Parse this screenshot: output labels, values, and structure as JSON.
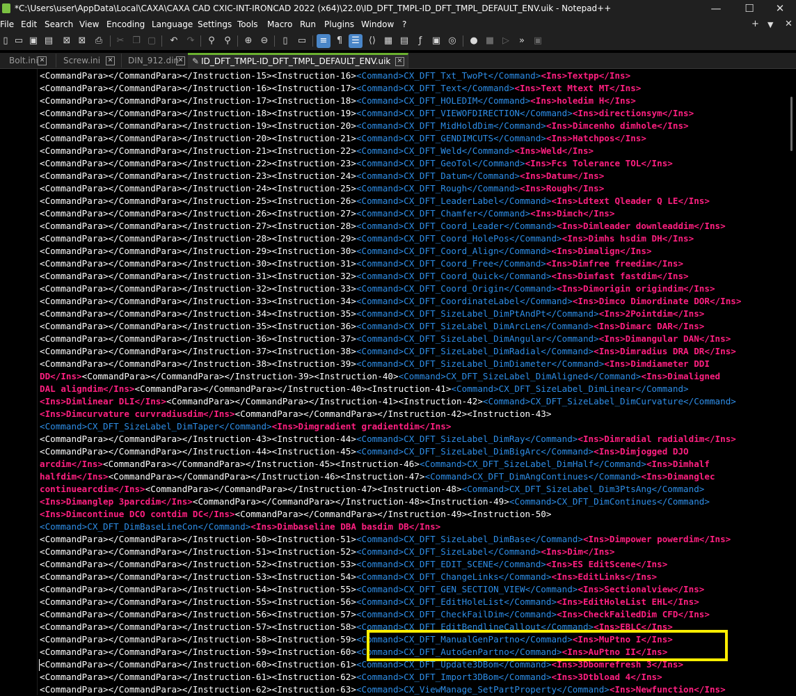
{
  "window": {
    "title": "*C:\\Users\\user\\AppData\\Local\\CAXA\\CAXA CAD CXIC-INT-IRONCAD 2022 (x64)\\22.0\\ID_DFT_TMPL-ID_DFT_TMPL_DEFAULT_ENV.uik - Notepad++",
    "minimize": "—",
    "maximize": "☐",
    "close": "✕"
  },
  "menu": {
    "items": [
      "File",
      "Edit",
      "Search",
      "View",
      "Encoding",
      "Language",
      "Settings",
      "Tools",
      "Macro",
      "Run",
      "Plugins",
      "Window",
      "?"
    ],
    "right": [
      "+",
      "▼",
      "✕"
    ]
  },
  "toolbar": {
    "icons": [
      "new-file-icon",
      "open-file-icon",
      "save-icon",
      "save-all-icon",
      "close-icon",
      "close-all-icon",
      "print-icon",
      "cut-icon",
      "copy-icon",
      "paste-icon",
      "undo-icon",
      "redo-icon",
      "find-icon",
      "replace-icon",
      "zoom-in-icon",
      "zoom-out-icon",
      "sync-vertical-icon",
      "sync-horizontal-icon",
      "word-wrap-icon",
      "show-all-chars-icon",
      "indent-guide-icon",
      "xml-tag-icon",
      "doc-map-icon",
      "folder-workspace-icon",
      "function-list-icon",
      "monitor-icon",
      "process-icon",
      "record-macro-icon",
      "stop-macro-icon",
      "play-macro-icon",
      "run-macro-multiple-icon",
      "save-macro-icon"
    ]
  },
  "tabs": [
    {
      "label": "Bolt.ini",
      "active": false
    },
    {
      "label": "Screw.ini",
      "active": false
    },
    {
      "label": "DIN_912.din",
      "active": false
    },
    {
      "label": "ID_DFT_TMPL-ID_DFT_TMPL_DEFAULT_ENV.uik",
      "active": true
    }
  ],
  "lines": [
    [
      [
        "w",
        "<CommandPara></CommandPara></Instruction-15><Instruction-16>"
      ],
      [
        "b",
        "<Command>CX_DFT_Txt_TwoPt</Command>"
      ],
      [
        "p",
        "<Ins>Textpp</Ins>"
      ]
    ],
    [
      [
        "w",
        "<CommandPara></CommandPara></Instruction-16><Instruction-17>"
      ],
      [
        "b",
        "<Command>CX_DFT_Text</Command>"
      ],
      [
        "p",
        "<Ins>Text Mtext MT</Ins>"
      ]
    ],
    [
      [
        "w",
        "<CommandPara></CommandPara></Instruction-17><Instruction-18>"
      ],
      [
        "b",
        "<Command>CX_DFT_HOLEDIM</Command>"
      ],
      [
        "p",
        "<Ins>holedim H</Ins>"
      ]
    ],
    [
      [
        "w",
        "<CommandPara></CommandPara></Instruction-18><Instruction-19>"
      ],
      [
        "b",
        "<Command>CX_DFT_VIEWOFDIRECTION</Command>"
      ],
      [
        "p",
        "<Ins>directionsym</Ins>"
      ]
    ],
    [
      [
        "w",
        "<CommandPara></CommandPara></Instruction-19><Instruction-20>"
      ],
      [
        "b",
        "<Command>CX_DFT_MidHoldDim</Command>"
      ],
      [
        "p",
        "<Ins>Dimcenho dimhole</Ins>"
      ]
    ],
    [
      [
        "w",
        "<CommandPara></CommandPara></Instruction-20><Instruction-21>"
      ],
      [
        "b",
        "<Command>CX_DFT_GENDIMCUTS</Command>"
      ],
      [
        "p",
        "<Ins>Hatchpos</Ins>"
      ]
    ],
    [
      [
        "w",
        "<CommandPara></CommandPara></Instruction-21><Instruction-22>"
      ],
      [
        "b",
        "<Command>CX_DFT_Weld</Command>"
      ],
      [
        "p",
        "<Ins>Weld</Ins>"
      ]
    ],
    [
      [
        "w",
        "<CommandPara></CommandPara></Instruction-22><Instruction-23>"
      ],
      [
        "b",
        "<Command>CX_DFT_GeoTol</Command>"
      ],
      [
        "p",
        "<Ins>Fcs Tolerance TOL</Ins>"
      ]
    ],
    [
      [
        "w",
        "<CommandPara></CommandPara></Instruction-23><Instruction-24>"
      ],
      [
        "b",
        "<Command>CX_DFT_Datum</Command>"
      ],
      [
        "p",
        "<Ins>Datum</Ins>"
      ]
    ],
    [
      [
        "w",
        "<CommandPara></CommandPara></Instruction-24><Instruction-25>"
      ],
      [
        "b",
        "<Command>CX_DFT_Rough</Command>"
      ],
      [
        "p",
        "<Ins>Rough</Ins>"
      ]
    ],
    [
      [
        "w",
        "<CommandPara></CommandPara></Instruction-25><Instruction-26>"
      ],
      [
        "b",
        "<Command>CX_DFT_LeaderLabel</Command>"
      ],
      [
        "p",
        "<Ins>Ldtext Qleader Q LE</Ins>"
      ]
    ],
    [
      [
        "w",
        "<CommandPara></CommandPara></Instruction-26><Instruction-27>"
      ],
      [
        "b",
        "<Command>CX_DFT_Chamfer</Command>"
      ],
      [
        "p",
        "<Ins>Dimch</Ins>"
      ]
    ],
    [
      [
        "w",
        "<CommandPara></CommandPara></Instruction-27><Instruction-28>"
      ],
      [
        "b",
        "<Command>CX_DFT_Coord_Leader</Command>"
      ],
      [
        "p",
        "<Ins>Dimleader downleaddim</Ins>"
      ]
    ],
    [
      [
        "w",
        "<CommandPara></CommandPara></Instruction-28><Instruction-29>"
      ],
      [
        "b",
        "<Command>CX_DFT_Coord_HolePos</Command>"
      ],
      [
        "p",
        "<Ins>Dimhs hsdim DH</Ins>"
      ]
    ],
    [
      [
        "w",
        "<CommandPara></CommandPara></Instruction-29><Instruction-30>"
      ],
      [
        "b",
        "<Command>CX_DFT_Coord_Align</Command>"
      ],
      [
        "p",
        "<Ins>Dimalign</Ins>"
      ]
    ],
    [
      [
        "w",
        "<CommandPara></CommandPara></Instruction-30><Instruction-31>"
      ],
      [
        "b",
        "<Command>CX_DFT_Coord_Free</Command>"
      ],
      [
        "p",
        "<Ins>Dimfree freedim</Ins>"
      ]
    ],
    [
      [
        "w",
        "<CommandPara></CommandPara></Instruction-31><Instruction-32>"
      ],
      [
        "b",
        "<Command>CX_DFT_Coord_Quick</Command>"
      ],
      [
        "p",
        "<Ins>Dimfast fastdim</Ins>"
      ]
    ],
    [
      [
        "w",
        "<CommandPara></CommandPara></Instruction-32><Instruction-33>"
      ],
      [
        "b",
        "<Command>CX_DFT_Coord_Origin</Command>"
      ],
      [
        "p",
        "<Ins>Dimorigin origindim</Ins>"
      ]
    ],
    [
      [
        "w",
        "<CommandPara></CommandPara></Instruction-33><Instruction-34>"
      ],
      [
        "b",
        "<Command>CX_DFT_CoordinateLabel</Command>"
      ],
      [
        "p",
        "<Ins>Dimco Dimordinate DOR</Ins>"
      ]
    ],
    [
      [
        "w",
        "<CommandPara></CommandPara></Instruction-34><Instruction-35>"
      ],
      [
        "b",
        "<Command>CX_DFT_SizeLabel_DimPtAndPt</Command>"
      ],
      [
        "p",
        "<Ins>2Pointdim</Ins>"
      ]
    ],
    [
      [
        "w",
        "<CommandPara></CommandPara></Instruction-35><Instruction-36>"
      ],
      [
        "b",
        "<Command>CX_DFT_SizeLabel_DimArcLen</Command>"
      ],
      [
        "p",
        "<Ins>Dimarc DAR</Ins>"
      ]
    ],
    [
      [
        "w",
        "<CommandPara></CommandPara></Instruction-36><Instruction-37>"
      ],
      [
        "b",
        "<Command>CX_DFT_SizeLabel_DimAngular</Command>"
      ],
      [
        "p",
        "<Ins>Dimangular DAN</Ins>"
      ]
    ],
    [
      [
        "w",
        "<CommandPara></CommandPara></Instruction-37><Instruction-38>"
      ],
      [
        "b",
        "<Command>CX_DFT_SizeLabel_DimRadial</Command>"
      ],
      [
        "p",
        "<Ins>Dimradius DRA DR</Ins>"
      ]
    ],
    [
      [
        "w",
        "<CommandPara></CommandPara></Instruction-38><Instruction-39>"
      ],
      [
        "b",
        "<Command>CX_DFT_SizeLabel_DimDiameter</Command>"
      ],
      [
        "p",
        "<Ins>Dimdiameter DDI"
      ]
    ],
    [
      [
        "p",
        "DD</Ins>"
      ],
      [
        "w",
        "<CommandPara></CommandPara></Instruction-39><Instruction-40>"
      ],
      [
        "b",
        "<Command>CX_DFT_SizeLabel_DimAligned</Command>"
      ],
      [
        "p",
        "<Ins>Dimaligned"
      ]
    ],
    [
      [
        "p",
        "DAL aligndim</Ins>"
      ],
      [
        "w",
        "<CommandPara></CommandPara></Instruction-40><Instruction-41>"
      ],
      [
        "b",
        "<Command>CX_DFT_SizeLabel_DimLinear</Command>"
      ]
    ],
    [
      [
        "p",
        "<Ins>Dimlinear DLI</Ins>"
      ],
      [
        "w",
        "<CommandPara></CommandPara></Instruction-41><Instruction-42>"
      ],
      [
        "b",
        "<Command>CX_DFT_SizeLabel_DimCurvature</Command>"
      ]
    ],
    [
      [
        "p",
        "<Ins>Dimcurvature curvradiusdim</Ins>"
      ],
      [
        "w",
        "<CommandPara></CommandPara></Instruction-42><Instruction-43>"
      ]
    ],
    [
      [
        "b",
        "<Command>CX_DFT_SizeLabel_DimTaper</Command>"
      ],
      [
        "p",
        "<Ins>Dimgradient gradientdim</Ins>"
      ]
    ],
    [
      [
        "w",
        "<CommandPara></CommandPara></Instruction-43><Instruction-44>"
      ],
      [
        "b",
        "<Command>CX_DFT_SizeLabel_DimRay</Command>"
      ],
      [
        "p",
        "<Ins>Dimradial radialdim</Ins>"
      ]
    ],
    [
      [
        "w",
        "<CommandPara></CommandPara></Instruction-44><Instruction-45>"
      ],
      [
        "b",
        "<Command>CX_DFT_SizeLabel_DimBigArc</Command>"
      ],
      [
        "p",
        "<Ins>Dimjogged DJO"
      ]
    ],
    [
      [
        "p",
        "arcdim</Ins>"
      ],
      [
        "w",
        "<CommandPara></CommandPara></Instruction-45><Instruction-46>"
      ],
      [
        "b",
        "<Command>CX_DFT_SizeLabel_DimHalf</Command>"
      ],
      [
        "p",
        "<Ins>Dimhalf"
      ]
    ],
    [
      [
        "p",
        "halfdim</Ins>"
      ],
      [
        "w",
        "<CommandPara></CommandPara></Instruction-46><Instruction-47>"
      ],
      [
        "b",
        "<Command>CX_DFT_DimAngContinues</Command>"
      ],
      [
        "p",
        "<Ins>Dimanglec"
      ]
    ],
    [
      [
        "p",
        "continuearcdim</Ins>"
      ],
      [
        "w",
        "<CommandPara></CommandPara></Instruction-47><Instruction-48>"
      ],
      [
        "b",
        "<Command>CX_DFT_SizeLabel_Dim3PtsAng</Command>"
      ]
    ],
    [
      [
        "p",
        "<Ins>Dimanglep 3parcdim</Ins>"
      ],
      [
        "w",
        "<CommandPara></CommandPara></Instruction-48><Instruction-49>"
      ],
      [
        "b",
        "<Command>CX_DFT_DimContinues</Command>"
      ]
    ],
    [
      [
        "p",
        "<Ins>Dimcontinue DCO contdim DC</Ins>"
      ],
      [
        "w",
        "<CommandPara></CommandPara></Instruction-49><Instruction-50>"
      ]
    ],
    [
      [
        "b",
        "<Command>CX_DFT_DimBaseLineCon</Command>"
      ],
      [
        "p",
        "<Ins>Dimbaseline DBA basdim DB</Ins>"
      ]
    ],
    [
      [
        "w",
        "<CommandPara></CommandPara></Instruction-50><Instruction-51>"
      ],
      [
        "b",
        "<Command>CX_DFT_SizeLabel_DimBase</Command>"
      ],
      [
        "p",
        "<Ins>Dimpower powerdim</Ins>"
      ]
    ],
    [
      [
        "w",
        "<CommandPara></CommandPara></Instruction-51><Instruction-52>"
      ],
      [
        "b",
        "<Command>CX_DFT_SizeLabel</Command>"
      ],
      [
        "p",
        "<Ins>Dim</Ins>"
      ]
    ],
    [
      [
        "w",
        "<CommandPara></CommandPara></Instruction-52><Instruction-53>"
      ],
      [
        "b",
        "<Command>CX_DFT_EDIT_SCENE</Command>"
      ],
      [
        "p",
        "<Ins>ES EditScene</Ins>"
      ]
    ],
    [
      [
        "w",
        "<CommandPara></CommandPara></Instruction-53><Instruction-54>"
      ],
      [
        "b",
        "<Command>CX_DFT_ChangeLinks</Command>"
      ],
      [
        "p",
        "<Ins>EditLinks</Ins>"
      ]
    ],
    [
      [
        "w",
        "<CommandPara></CommandPara></Instruction-54><Instruction-55>"
      ],
      [
        "b",
        "<Command>CX_DFT_GEN_SECTION_VIEW</Command>"
      ],
      [
        "p",
        "<Ins>Sectionalview</Ins>"
      ]
    ],
    [
      [
        "w",
        "<CommandPara></CommandPara></Instruction-55><Instruction-56>"
      ],
      [
        "b",
        "<Command>CX_DFT_EditHoleList</Command>"
      ],
      [
        "p",
        "<Ins>EditHoleList EHL</Ins>"
      ]
    ],
    [
      [
        "w",
        "<CommandPara></CommandPara></Instruction-56><Instruction-57>"
      ],
      [
        "b",
        "<Command>CX_DFT_CheckFailDim</Command>"
      ],
      [
        "p",
        "<Ins>CheckFailedDim CFD</Ins>"
      ]
    ],
    [
      [
        "w",
        "<CommandPara></CommandPara></Instruction-57><Instruction-58>"
      ],
      [
        "b",
        "<Command>CX_DFT_EditBendlineCallout</Command>"
      ],
      [
        "p",
        "<Ins>EBLC</Ins>"
      ]
    ],
    [
      [
        "w",
        "<CommandPara></CommandPara></Instruction-58><Instruction-59>"
      ],
      [
        "b",
        "<Command>CX_DFT_ManualGenPartno</Command>"
      ],
      [
        "p",
        "<Ins>MuPtno I</Ins>"
      ]
    ],
    [
      [
        "w",
        "<CommandPara></CommandPara></Instruction-59><Instruction-60>"
      ],
      [
        "b",
        "<Command>CX_DFT_AutoGenPartno</Command>"
      ],
      [
        "p",
        "<Ins>AuPtno II</Ins>"
      ]
    ],
    [
      [
        "w",
        "<CommandPara></CommandPara></Instruction-60><Instruction-61>"
      ],
      [
        "b",
        "<Command>CX_DFT_Update3DBom</Command>"
      ],
      [
        "p",
        "<Ins>3Dbomrefresh 3</Ins>"
      ]
    ],
    [
      [
        "w",
        "<CommandPara></CommandPara></Instruction-61><Instruction-62>"
      ],
      [
        "b",
        "<Command>CX_DFT_Import3DBom</Command>"
      ],
      [
        "p",
        "<Ins>3Dtbload 4</Ins>"
      ]
    ],
    [
      [
        "w",
        "<CommandPara></CommandPara></Instruction-62><Instruction-63>"
      ],
      [
        "b",
        "<Command>CX_ViewManage_SetPartProperty</Command>"
      ],
      [
        "p",
        "<Ins>Newfunction</Ins>"
      ]
    ]
  ],
  "colors": {
    "text": "#ffffff",
    "tag_command": "#2e8ee8",
    "tag_ins": "#ff1f80",
    "highlight": "#ffee00",
    "tab_accent": "#6ab02f"
  }
}
